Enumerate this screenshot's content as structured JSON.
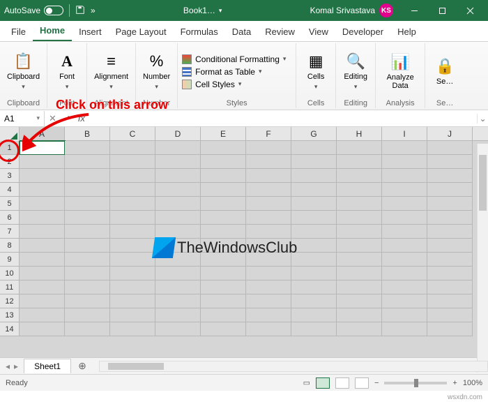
{
  "titlebar": {
    "autosave_label": "AutoSave",
    "autosave_state": "Off",
    "doc_title": "Book1…",
    "user_name": "Komal Srivastava",
    "user_initials": "KS"
  },
  "tabs": {
    "items": [
      "File",
      "Home",
      "Insert",
      "Page Layout",
      "Formulas",
      "Data",
      "Review",
      "View",
      "Developer",
      "Help"
    ],
    "active_index": 1
  },
  "ribbon": {
    "clipboard": {
      "label": "Clipboard",
      "button": "Clipboard"
    },
    "font": {
      "label": "Font",
      "button": "Font"
    },
    "alignment": {
      "label": "Alignment",
      "button": "Alignment"
    },
    "number": {
      "label": "Number",
      "button": "Number"
    },
    "styles": {
      "label": "Styles",
      "cond": "Conditional Formatting",
      "table": "Format as Table",
      "cell": "Cell Styles"
    },
    "cells": {
      "label": "Cells",
      "button": "Cells"
    },
    "editing": {
      "label": "Editing",
      "button": "Editing"
    },
    "analyze": {
      "label": "Analysis",
      "button": "Analyze Data"
    },
    "sens": {
      "label": "Se…",
      "button": "Se…"
    }
  },
  "namebox": {
    "value": "A1",
    "fx_label": "fx"
  },
  "columns": [
    "A",
    "B",
    "C",
    "D",
    "E",
    "F",
    "G",
    "H",
    "I",
    "J"
  ],
  "rows": [
    "1",
    "2",
    "3",
    "4",
    "5",
    "6",
    "7",
    "8",
    "9",
    "10",
    "11",
    "12",
    "13",
    "14"
  ],
  "active_cell": {
    "row": 0,
    "col": 0
  },
  "sheet": {
    "name": "Sheet1",
    "add": "+"
  },
  "status": {
    "ready": "Ready",
    "zoom": "100%",
    "minus": "−",
    "plus": "+"
  },
  "annotation": {
    "text": "Click on this arrow"
  },
  "watermark": {
    "text": "TheWindowsClub"
  },
  "credit": {
    "text": "wsxdn.com"
  }
}
